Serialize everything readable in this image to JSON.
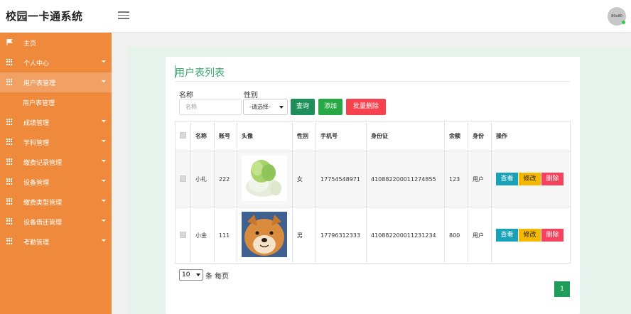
{
  "header": {
    "brand": "校园一卡通系统",
    "avatar_text": "80x80"
  },
  "sidebar": {
    "items": [
      {
        "label": "主页",
        "icon": "flag-icon",
        "expandable": false
      },
      {
        "label": "个人中心",
        "icon": "grid-icon",
        "expandable": true
      },
      {
        "label": "用户表管理",
        "icon": "grid-icon",
        "expandable": true,
        "active": true
      },
      {
        "label": "用户表管理",
        "sub": true
      },
      {
        "label": "成绩管理",
        "icon": "grid-icon",
        "expandable": true
      },
      {
        "label": "学科管理",
        "icon": "grid-icon",
        "expandable": true
      },
      {
        "label": "缴费记录管理",
        "icon": "grid-icon",
        "expandable": true
      },
      {
        "label": "设备管理",
        "icon": "grid-icon",
        "expandable": true
      },
      {
        "label": "缴费类型管理",
        "icon": "grid-icon",
        "expandable": true
      },
      {
        "label": "设备借还管理",
        "icon": "grid-icon",
        "expandable": true
      },
      {
        "label": "考勤管理",
        "icon": "grid-icon",
        "expandable": true
      }
    ]
  },
  "page": {
    "title": "用户表列表"
  },
  "filters": {
    "name_label": "名称",
    "name_placeholder": "名称",
    "gender_label": "性别",
    "gender_selected": "-请选择-",
    "query_button": "查询",
    "add_button": "添加",
    "batch_delete_button": "批量删除"
  },
  "table": {
    "headers": [
      "名称",
      "账号",
      "头像",
      "性别",
      "手机号",
      "身份证",
      "余额",
      "身份",
      "操作"
    ],
    "rows": [
      {
        "name": "小礼",
        "account": "222",
        "avatar": "cabbage-image",
        "gender": "女",
        "phone": "17754548971",
        "id_card": "410882200011274855",
        "balance": "123",
        "role": "用户"
      },
      {
        "name": "小金",
        "account": "111",
        "avatar": "shiba-dog-image",
        "gender": "男",
        "phone": "17796312333",
        "id_card": "410882200011231234",
        "balance": "800",
        "role": "用户"
      }
    ],
    "actions": {
      "view": "查看",
      "edit": "修改",
      "delete": "删除"
    }
  },
  "pager": {
    "page_size": "10",
    "per_page_text": "条 每页",
    "current_page": "1"
  },
  "colors": {
    "sidebar": "#ef8a3c",
    "accent_green": "#3aa872",
    "query": "#1e8f5a",
    "add": "#28a745",
    "batch_delete": "#f5424e",
    "view": "#17a2b8",
    "edit": "#f5b800",
    "delete": "#f5425d"
  }
}
